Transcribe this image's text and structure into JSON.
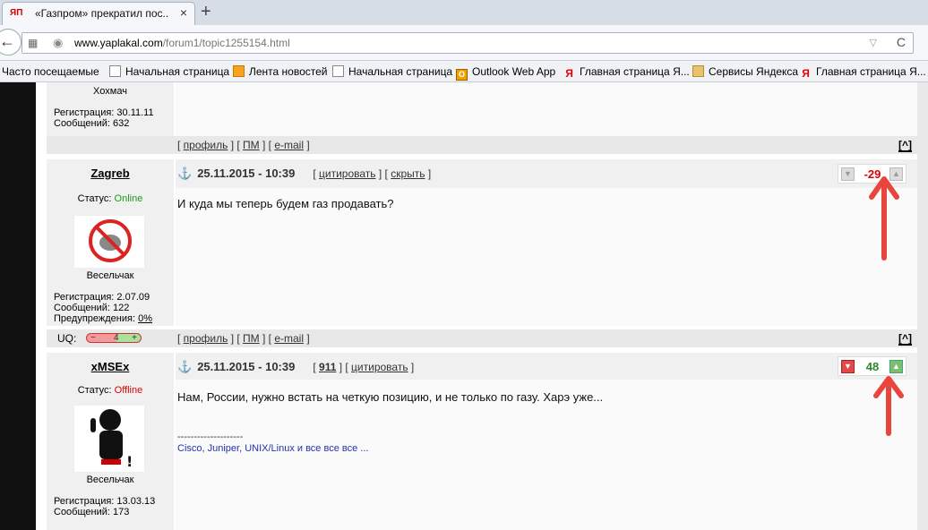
{
  "browser": {
    "tab_favicon": "ЯП",
    "tab_title": "«Газпром» прекратил пос...",
    "tab_close": "×",
    "new_tab": "+",
    "url_domain": "www.yaplakal.com",
    "url_path": "/forum1/topic1255154.html",
    "back": "←",
    "reload": "C"
  },
  "bookmarks": [
    {
      "label": "Часто посещаемые",
      "icon": "none"
    },
    {
      "label": "Начальная страница",
      "icon": "page-icon"
    },
    {
      "label": "Лента новостей",
      "icon": "rss-icon"
    },
    {
      "label": "Начальная страница",
      "icon": "page-icon"
    },
    {
      "label": "Outlook Web App",
      "icon": "outlook-icon"
    },
    {
      "label": "Главная страница Я...",
      "icon": "yandex-icon"
    },
    {
      "label": "Сервисы Яндекса",
      "icon": "folder-icon"
    },
    {
      "label": "Главная страница Я...",
      "icon": "yandex-icon"
    }
  ],
  "prev_post": {
    "rank": "Хохмач",
    "registration": "Регистрация: 30.11.11",
    "messages": "Сообщений: 632",
    "links": {
      "profile": "профиль",
      "pm": "ПМ",
      "email": "e-mail"
    },
    "to_top": "[^]"
  },
  "post1": {
    "nick": "Zagreb",
    "status_label": "Статус: ",
    "status": "Online",
    "date": "25.11.2015 - 10:39",
    "quote": "цитировать",
    "hide": "скрыть",
    "rating": "-29",
    "text": "И куда мы теперь будем газ продавать?",
    "rank": "Весельчак",
    "registration": "Регистрация: 2.07.09",
    "messages": "Сообщений: 122",
    "warnings_label": "Предупреждения: ",
    "warnings": "0%",
    "uq_label": "UQ:",
    "uq_minus": "−",
    "uq_value": "4",
    "uq_plus": "+",
    "links": {
      "profile": "профиль",
      "pm": "ПМ",
      "email": "e-mail"
    },
    "to_top": "[^]"
  },
  "post2": {
    "nick": "xMSEx",
    "status_label": "Статус: ",
    "status": "Offline",
    "date": "25.11.2015 - 10:39",
    "reply_count": "911",
    "quote": "цитировать",
    "rating": "48",
    "text": "Нам, России, нужно встать на четкую позицию, и не только по газу. Харэ уже...",
    "sig_line": "--------------------",
    "signature": "Cisco, Juniper, UNIX/Linux и все все все ...",
    "rank": "Весельчак",
    "registration": "Регистрация: 13.03.13",
    "messages": "Сообщений: 173"
  },
  "colors": {
    "arrow": "#e8453c",
    "negative": "#dd0000",
    "positive": "#2a8a2a",
    "online": "#1a9a1a",
    "offline": "#dd0000"
  }
}
